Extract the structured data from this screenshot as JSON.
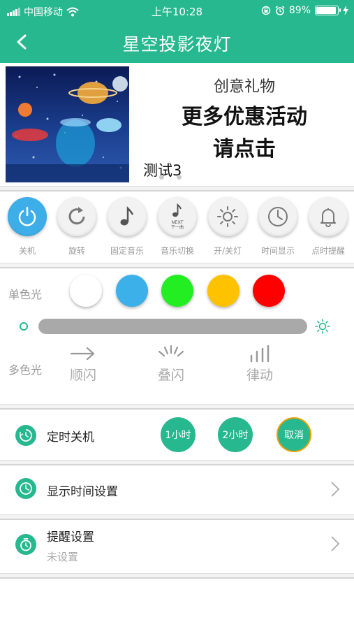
{
  "status_bar": {
    "carrier": "中国移动",
    "time": "上午10:28",
    "battery_text": "89%",
    "battery_level": 0.89,
    "icons": [
      "signal-icon",
      "wifi-icon",
      "rotation-lock-icon",
      "alarm-icon",
      "battery-icon",
      "charging-icon"
    ]
  },
  "nav": {
    "title": "星空投影夜灯",
    "back_icon": "back-chevron-icon"
  },
  "banner": {
    "line1": "创意礼物",
    "line2": "更多优惠活动",
    "line3": "请点击",
    "caption": "测试3",
    "page_count": 2
  },
  "functions": [
    {
      "label": "关机",
      "icon": "power-icon",
      "active": true
    },
    {
      "label": "旋转",
      "icon": "rotate-icon",
      "active": false
    },
    {
      "label": "固定音乐",
      "icon": "music-note-icon",
      "active": false
    },
    {
      "label": "音乐切换",
      "icon": "next-song-icon",
      "active": false,
      "icon_text_1": "NEXT",
      "icon_text_2": "下一曲"
    },
    {
      "label": "开/关灯",
      "icon": "sun-icon",
      "active": false
    },
    {
      "label": "时间显示",
      "icon": "clock-icon",
      "active": false
    },
    {
      "label": "点时提醒",
      "icon": "bell-icon",
      "active": false
    }
  ],
  "single_color": {
    "label": "单色光",
    "swatches": [
      "#ffffff",
      "#3cb0e8",
      "#22ee22",
      "#ffc200",
      "#ff0000"
    ]
  },
  "brightness": {
    "level": 1.0,
    "min_icon": "dim-circle-icon",
    "max_icon": "bright-sun-icon"
  },
  "multi_color": {
    "label": "多色光",
    "modes": [
      {
        "label": "顺闪",
        "icon": "arrow-right-icon"
      },
      {
        "label": "叠闪",
        "icon": "burst-icon"
      },
      {
        "label": "律动",
        "icon": "bars-icon"
      }
    ]
  },
  "timer": {
    "title": "定时关机",
    "icon": "timer-icon",
    "buttons": [
      "1小时",
      "2小时",
      "取消"
    ]
  },
  "display_time": {
    "title": "显示时间设置",
    "icon": "clock-icon"
  },
  "reminder": {
    "title": "提醒设置",
    "subtitle": "未设置",
    "icon": "stopwatch-icon"
  },
  "colors": {
    "accent": "#27b88f",
    "active_button": "#3eaee8",
    "cancel_border": "#f0a000"
  }
}
